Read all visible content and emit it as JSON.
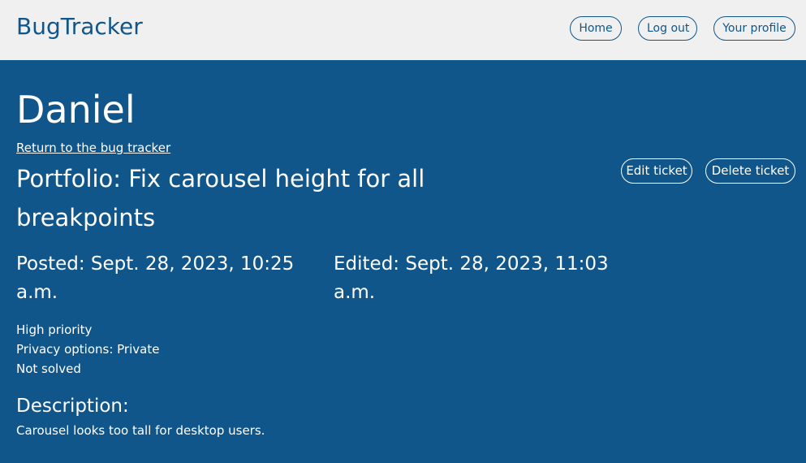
{
  "header": {
    "brand": "BugTracker",
    "nav": {
      "home": "Home",
      "logout": "Log out",
      "profile": "Your profile"
    }
  },
  "colors": {
    "primary": "#10568a",
    "header_bg": "#f0f0f0",
    "text_on_primary": "#ffffff"
  },
  "page": {
    "user_name": "Daniel",
    "return_link": "Return to the bug tracker"
  },
  "ticket": {
    "title": "Portfolio: Fix carousel height for all breakpoints",
    "posted": "Posted: Sept. 28, 2023, 10:25 a.m.",
    "edited": "Edited: Sept. 28, 2023, 11:03 a.m.",
    "priority": "High priority",
    "privacy": "Privacy options: Private",
    "status": "Not solved",
    "description_heading": "Description:",
    "description": "Carousel looks too tall for desktop users.",
    "actions": {
      "edit": "Edit ticket",
      "delete": "Delete ticket"
    }
  }
}
